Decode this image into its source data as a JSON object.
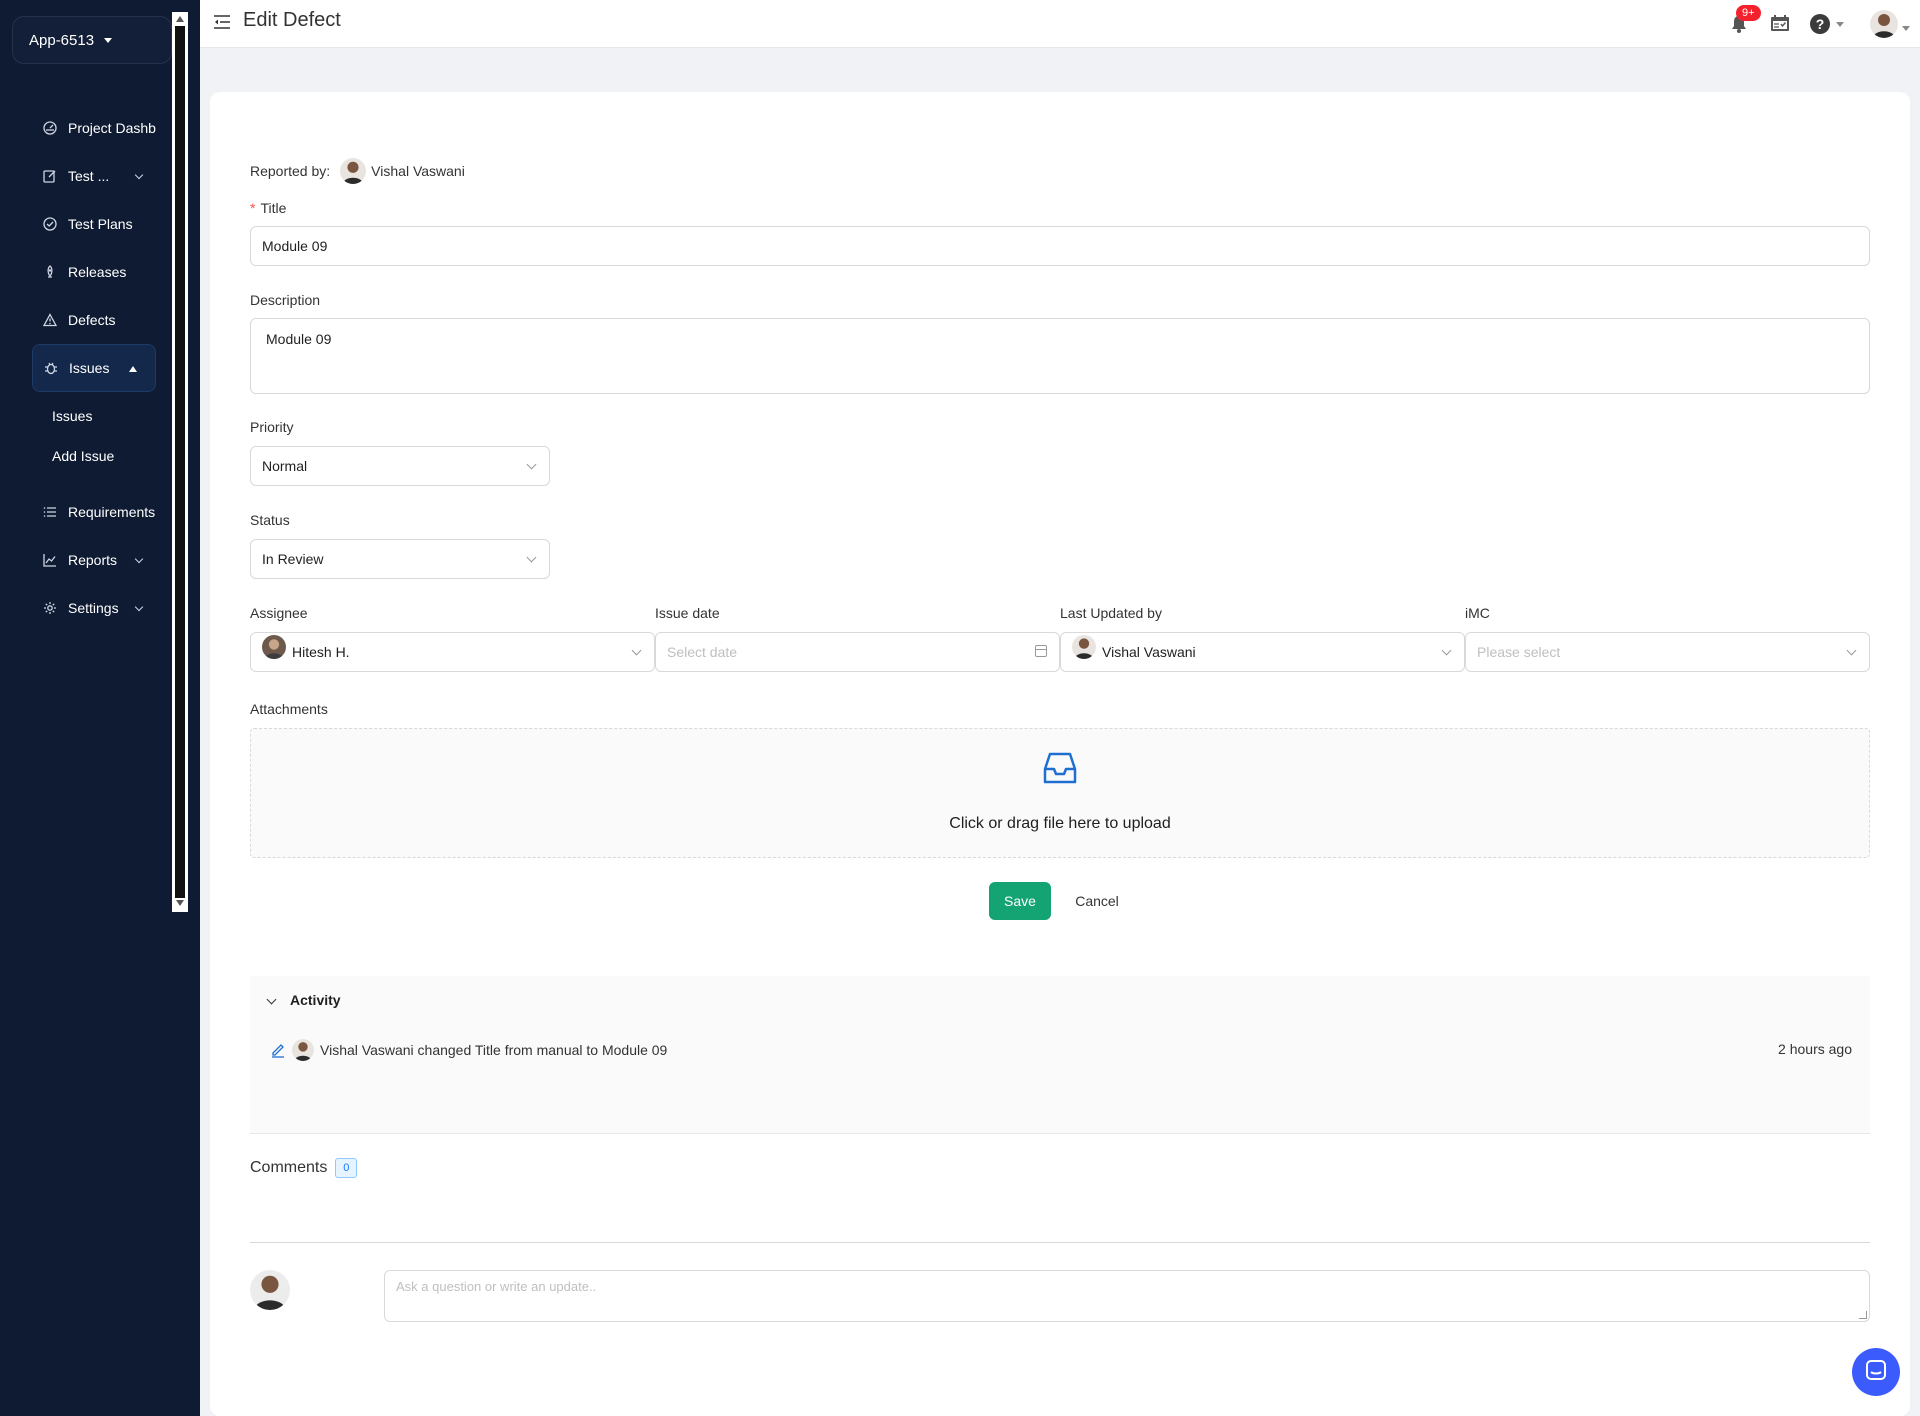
{
  "app": {
    "switcher_label": "App-6513"
  },
  "sidebar": {
    "items": [
      {
        "label": "Project Dashb",
        "icon": "dashboard-icon"
      },
      {
        "label": "Test ...",
        "icon": "edit-icon"
      },
      {
        "label": "Test Plans",
        "icon": "check-circle-icon"
      },
      {
        "label": "Releases",
        "icon": "rocket-icon"
      },
      {
        "label": "Defects",
        "icon": "warning-icon"
      },
      {
        "label": "Issues",
        "icon": "bug-icon"
      },
      {
        "label": "Requirements",
        "icon": "list-icon"
      },
      {
        "label": "Reports",
        "icon": "chart-icon"
      },
      {
        "label": "Settings",
        "icon": "gear-icon"
      }
    ],
    "issues_sub": [
      "Issues",
      "Add Issue"
    ]
  },
  "header": {
    "title": "Edit Defect",
    "notification_badge": "9+"
  },
  "form": {
    "reported_by_label": "Reported by:",
    "reported_by_name": "Vishal Vaswani",
    "title_label": "Title",
    "title_required_mark": "*",
    "title_value": "Module 09",
    "description_label": "Description",
    "description_value": "Module 09",
    "priority_label": "Priority",
    "priority_value": "Normal",
    "status_label": "Status",
    "status_value": "In Review",
    "assignee_label": "Assignee",
    "assignee_value": "Hitesh H.",
    "issue_date_label": "Issue date",
    "issue_date_placeholder": "Select date",
    "last_updated_label": "Last Updated by",
    "last_updated_value": "Vishal Vaswani",
    "imc_label": "iMC",
    "imc_placeholder": "Please select",
    "attachments_label": "Attachments",
    "upload_text": "Click or drag file here to upload",
    "save_label": "Save",
    "cancel_label": "Cancel"
  },
  "activity": {
    "title": "Activity",
    "entries": [
      {
        "text": "Vishal Vaswani changed Title from manual to Module 09",
        "time": "2 hours ago"
      }
    ]
  },
  "comments": {
    "title": "Comments",
    "count": "0",
    "placeholder": "Ask a question or write an update.."
  },
  "colors": {
    "sidebar_bg": "#0f1b33",
    "primary_green": "#14a372",
    "badge_red": "#f5222d",
    "chat_blue": "#3b5bfd"
  }
}
